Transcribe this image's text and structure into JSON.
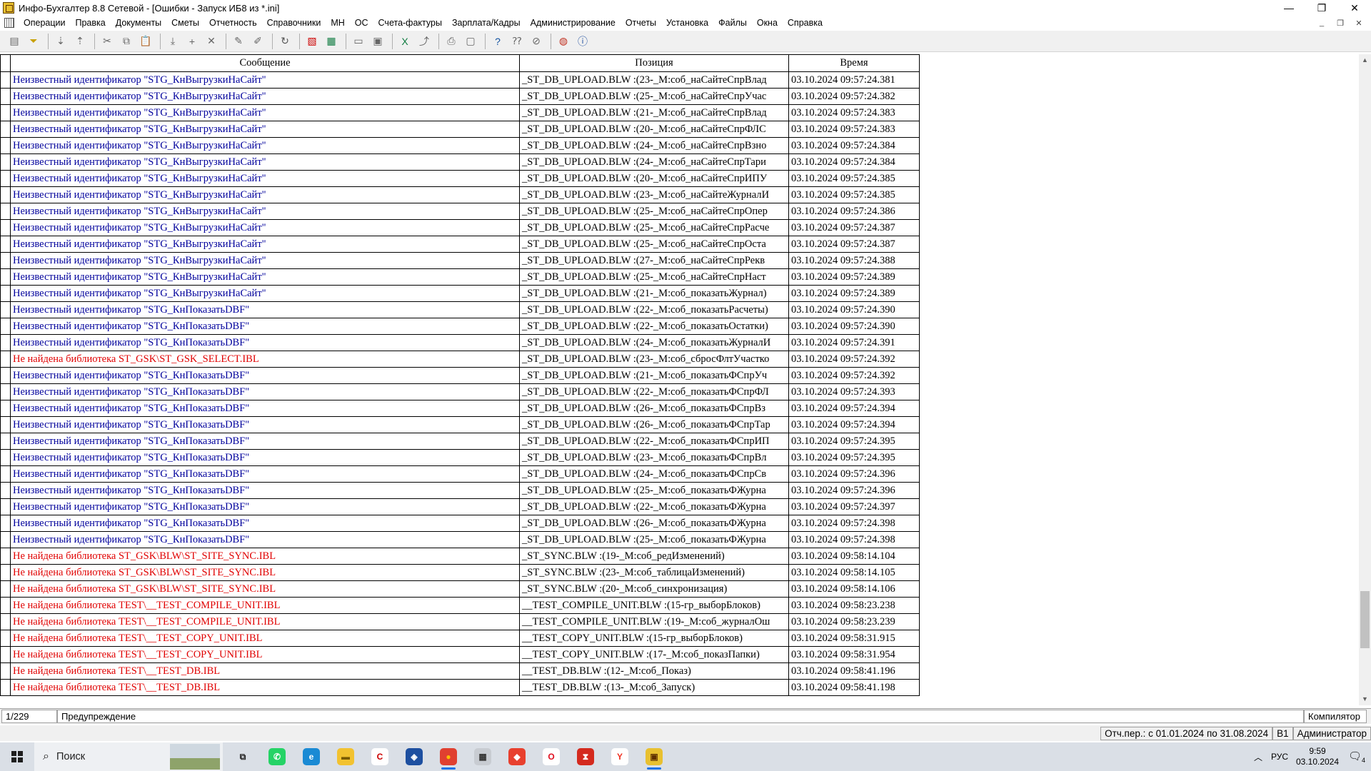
{
  "window": {
    "title": "Инфо-Бухгалтер 8.8 Сетевой - [Ошибки - Запуск ИБ8 из *.ini]",
    "minimize": "—",
    "restore": "❐",
    "close": "✕"
  },
  "menu": [
    "Операции",
    "Правка",
    "Документы",
    "Сметы",
    "Отчетность",
    "Справочники",
    "МН",
    "ОС",
    "Счета-фактуры",
    "Зарплата/Кадры",
    "Администрирование",
    "Отчеты",
    "Установка",
    "Файлы",
    "Окна",
    "Справка"
  ],
  "toolbar_icons": [
    "table-icon",
    "filter-icon",
    "sort-asc-icon",
    "sort-desc-icon",
    "cut-icon",
    "copy-icon",
    "paste-icon",
    "insert-row-icon",
    "add-icon",
    "delete-icon",
    "mark-icon",
    "unmark-icon",
    "refresh-icon",
    "pdf-icon",
    "calculator-icon",
    "open-icon",
    "save-icon",
    "excel-icon",
    "export-icon",
    "print-icon",
    "preview-icon",
    "help-icon",
    "context-help-icon",
    "compass-icon",
    "web-icon",
    "info-icon"
  ],
  "table": {
    "columns": [
      "Сообщение",
      "Позиция",
      "Время"
    ],
    "rows": [
      {
        "msg": "Неизвестный идентификатор \"STG_КнВыгрузкиНаСайт\"",
        "pos": "_ST_DB_UPLOAD.BLW :(23-_М:соб_наСайтеСпрВлад",
        "time": "03.10.2024 09:57:24.381",
        "level": "warn"
      },
      {
        "msg": "Неизвестный идентификатор \"STG_КнВыгрузкиНаСайт\"",
        "pos": "_ST_DB_UPLOAD.BLW :(25-_М:соб_наСайтеСпрУчас",
        "time": "03.10.2024 09:57:24.382",
        "level": "warn"
      },
      {
        "msg": "Неизвестный идентификатор \"STG_КнВыгрузкиНаСайт\"",
        "pos": "_ST_DB_UPLOAD.BLW :(21-_М:соб_наСайтеСпрВлад",
        "time": "03.10.2024 09:57:24.383",
        "level": "warn"
      },
      {
        "msg": "Неизвестный идентификатор \"STG_КнВыгрузкиНаСайт\"",
        "pos": "_ST_DB_UPLOAD.BLW :(20-_М:соб_наСайтеСпрФЛС",
        "time": "03.10.2024 09:57:24.383",
        "level": "warn"
      },
      {
        "msg": "Неизвестный идентификатор \"STG_КнВыгрузкиНаСайт\"",
        "pos": "_ST_DB_UPLOAD.BLW :(24-_М:соб_наСайтеСпрВзно",
        "time": "03.10.2024 09:57:24.384",
        "level": "warn"
      },
      {
        "msg": "Неизвестный идентификатор \"STG_КнВыгрузкиНаСайт\"",
        "pos": "_ST_DB_UPLOAD.BLW :(24-_М:соб_наСайтеСпрТари",
        "time": "03.10.2024 09:57:24.384",
        "level": "warn"
      },
      {
        "msg": "Неизвестный идентификатор \"STG_КнВыгрузкиНаСайт\"",
        "pos": "_ST_DB_UPLOAD.BLW :(20-_М:соб_наСайтеСпрИПУ",
        "time": "03.10.2024 09:57:24.385",
        "level": "warn"
      },
      {
        "msg": "Неизвестный идентификатор \"STG_КнВыгрузкиНаСайт\"",
        "pos": "_ST_DB_UPLOAD.BLW :(23-_М:соб_наСайтеЖурналИ",
        "time": "03.10.2024 09:57:24.385",
        "level": "warn"
      },
      {
        "msg": "Неизвестный идентификатор \"STG_КнВыгрузкиНаСайт\"",
        "pos": "_ST_DB_UPLOAD.BLW :(25-_М:соб_наСайтеСпрОпер",
        "time": "03.10.2024 09:57:24.386",
        "level": "warn"
      },
      {
        "msg": "Неизвестный идентификатор \"STG_КнВыгрузкиНаСайт\"",
        "pos": "_ST_DB_UPLOAD.BLW :(25-_М:соб_наСайтеСпрРасче",
        "time": "03.10.2024 09:57:24.387",
        "level": "warn"
      },
      {
        "msg": "Неизвестный идентификатор \"STG_КнВыгрузкиНаСайт\"",
        "pos": "_ST_DB_UPLOAD.BLW :(25-_М:соб_наСайтеСпрОста",
        "time": "03.10.2024 09:57:24.387",
        "level": "warn"
      },
      {
        "msg": "Неизвестный идентификатор \"STG_КнВыгрузкиНаСайт\"",
        "pos": "_ST_DB_UPLOAD.BLW :(27-_М:соб_наСайтеСпрРекв",
        "time": "03.10.2024 09:57:24.388",
        "level": "warn"
      },
      {
        "msg": "Неизвестный идентификатор \"STG_КнВыгрузкиНаСайт\"",
        "pos": "_ST_DB_UPLOAD.BLW :(25-_М:соб_наСайтеСпрНаст",
        "time": "03.10.2024 09:57:24.389",
        "level": "warn"
      },
      {
        "msg": "Неизвестный идентификатор \"STG_КнВыгрузкиНаСайт\"",
        "pos": "_ST_DB_UPLOAD.BLW :(21-_М:соб_показатьЖурнал)",
        "time": "03.10.2024 09:57:24.389",
        "level": "warn"
      },
      {
        "msg": "Неизвестный идентификатор \"STG_КнПоказатьDBF\"",
        "pos": "_ST_DB_UPLOAD.BLW :(22-_М:соб_показатьРасчеты)",
        "time": "03.10.2024 09:57:24.390",
        "level": "warn"
      },
      {
        "msg": "Неизвестный идентификатор \"STG_КнПоказатьDBF\"",
        "pos": "_ST_DB_UPLOAD.BLW :(22-_М:соб_показатьОстатки)",
        "time": "03.10.2024 09:57:24.390",
        "level": "warn"
      },
      {
        "msg": "Неизвестный идентификатор \"STG_КнПоказатьDBF\"",
        "pos": "_ST_DB_UPLOAD.BLW :(24-_М:соб_показатьЖурналИ",
        "time": "03.10.2024 09:57:24.391",
        "level": "warn"
      },
      {
        "msg": "Не найдена библиотека ST_GSK\\ST_GSK_SELECT.IBL",
        "pos": "_ST_DB_UPLOAD.BLW :(23-_М:соб_сбросФлтУчастко",
        "time": "03.10.2024 09:57:24.392",
        "level": "error"
      },
      {
        "msg": "Неизвестный идентификатор \"STG_КнПоказатьDBF\"",
        "pos": "_ST_DB_UPLOAD.BLW :(21-_М:соб_показатьФСпрУч",
        "time": "03.10.2024 09:57:24.392",
        "level": "warn"
      },
      {
        "msg": "Неизвестный идентификатор \"STG_КнПоказатьDBF\"",
        "pos": "_ST_DB_UPLOAD.BLW :(22-_М:соб_показатьФСпрФЛ",
        "time": "03.10.2024 09:57:24.393",
        "level": "warn"
      },
      {
        "msg": "Неизвестный идентификатор \"STG_КнПоказатьDBF\"",
        "pos": "_ST_DB_UPLOAD.BLW :(26-_М:соб_показатьФСпрВз",
        "time": "03.10.2024 09:57:24.394",
        "level": "warn"
      },
      {
        "msg": "Неизвестный идентификатор \"STG_КнПоказатьDBF\"",
        "pos": "_ST_DB_UPLOAD.BLW :(26-_М:соб_показатьФСпрТар",
        "time": "03.10.2024 09:57:24.394",
        "level": "warn"
      },
      {
        "msg": "Неизвестный идентификатор \"STG_КнПоказатьDBF\"",
        "pos": "_ST_DB_UPLOAD.BLW :(22-_М:соб_показатьФСпрИП",
        "time": "03.10.2024 09:57:24.395",
        "level": "warn"
      },
      {
        "msg": "Неизвестный идентификатор \"STG_КнПоказатьDBF\"",
        "pos": "_ST_DB_UPLOAD.BLW :(23-_М:соб_показатьФСпрВл",
        "time": "03.10.2024 09:57:24.395",
        "level": "warn"
      },
      {
        "msg": "Неизвестный идентификатор \"STG_КнПоказатьDBF\"",
        "pos": "_ST_DB_UPLOAD.BLW :(24-_М:соб_показатьФСпрСв",
        "time": "03.10.2024 09:57:24.396",
        "level": "warn"
      },
      {
        "msg": "Неизвестный идентификатор \"STG_КнПоказатьDBF\"",
        "pos": "_ST_DB_UPLOAD.BLW :(25-_М:соб_показатьФЖурна",
        "time": "03.10.2024 09:57:24.396",
        "level": "warn"
      },
      {
        "msg": "Неизвестный идентификатор \"STG_КнПоказатьDBF\"",
        "pos": "_ST_DB_UPLOAD.BLW :(22-_М:соб_показатьФЖурна",
        "time": "03.10.2024 09:57:24.397",
        "level": "warn"
      },
      {
        "msg": "Неизвестный идентификатор \"STG_КнПоказатьDBF\"",
        "pos": "_ST_DB_UPLOAD.BLW :(26-_М:соб_показатьФЖурна",
        "time": "03.10.2024 09:57:24.398",
        "level": "warn"
      },
      {
        "msg": "Неизвестный идентификатор \"STG_КнПоказатьDBF\"",
        "pos": "_ST_DB_UPLOAD.BLW :(25-_М:соб_показатьФЖурна",
        "time": "03.10.2024 09:57:24.398",
        "level": "warn"
      },
      {
        "msg": "Не найдена библиотека ST_GSK\\BLW\\ST_SITE_SYNC.IBL",
        "pos": "_ST_SYNC.BLW :(19-_М:соб_редИзменений)",
        "time": "03.10.2024 09:58:14.104",
        "level": "error"
      },
      {
        "msg": "Не найдена библиотека ST_GSK\\BLW\\ST_SITE_SYNC.IBL",
        "pos": "_ST_SYNC.BLW :(23-_М:соб_таблицаИзменений)",
        "time": "03.10.2024 09:58:14.105",
        "level": "error"
      },
      {
        "msg": "Не найдена библиотека ST_GSK\\BLW\\ST_SITE_SYNC.IBL",
        "pos": "_ST_SYNC.BLW :(20-_М:соб_синхронизация)",
        "time": "03.10.2024 09:58:14.106",
        "level": "error"
      },
      {
        "msg": "Не найдена библиотека TEST\\__TEST_COMPILE_UNIT.IBL",
        "pos": "__TEST_COMPILE_UNIT.BLW :(15-гр_выборБлоков)",
        "time": "03.10.2024 09:58:23.238",
        "level": "error"
      },
      {
        "msg": "Не найдена библиотека TEST\\__TEST_COMPILE_UNIT.IBL",
        "pos": "__TEST_COMPILE_UNIT.BLW :(19-_М:соб_журналОш",
        "time": "03.10.2024 09:58:23.239",
        "level": "error"
      },
      {
        "msg": "Не найдена библиотека TEST\\__TEST_COPY_UNIT.IBL",
        "pos": "__TEST_COPY_UNIT.BLW :(15-гр_выборБлоков)",
        "time": "03.10.2024 09:58:31.915",
        "level": "error"
      },
      {
        "msg": "Не найдена библиотека TEST\\__TEST_COPY_UNIT.IBL",
        "pos": "__TEST_COPY_UNIT.BLW :(17-_М:соб_показПапки)",
        "time": "03.10.2024 09:58:31.954",
        "level": "error"
      },
      {
        "msg": "Не найдена библиотека TEST\\__TEST_DB.IBL",
        "pos": "__TEST_DB.BLW :(12-_М:соб_Показ)",
        "time": "03.10.2024 09:58:41.196",
        "level": "error"
      },
      {
        "msg": "Не найдена библиотека TEST\\__TEST_DB.IBL",
        "pos": "__TEST_DB.BLW :(13-_М:соб_Запуск)",
        "time": "03.10.2024 09:58:41.198",
        "level": "error"
      }
    ]
  },
  "status": {
    "counter": "1/229",
    "type": "Предупреждение",
    "source": "Компилятор"
  },
  "status2": {
    "period": "Отч.пер.: с 01.01.2024 по 31.08.2024",
    "code": "В1",
    "user": "Администратор"
  },
  "taskbar": {
    "search_placeholder": "Поиск",
    "apps": [
      {
        "name": "task-view-icon",
        "glyph": "⧉",
        "color": "#dadfe6",
        "fg": "#222"
      },
      {
        "name": "whatsapp-icon",
        "glyph": "✆",
        "color": "#25d366",
        "fg": "#fff"
      },
      {
        "name": "edge-icon",
        "glyph": "e",
        "color": "#1a8ad4",
        "fg": "#fff"
      },
      {
        "name": "file-explorer-icon",
        "glyph": "▬",
        "color": "#f2c230",
        "fg": "#7a5a00"
      },
      {
        "name": "ccleaner-icon",
        "glyph": "C",
        "color": "#ffffff",
        "fg": "#c00"
      },
      {
        "name": "app-blue-icon",
        "glyph": "◈",
        "color": "#1d4fa0",
        "fg": "#fff"
      },
      {
        "name": "chrome-icon",
        "glyph": "●",
        "color": "#e04030",
        "fg": "#fbc000"
      },
      {
        "name": "calculator-app-icon",
        "glyph": "▦",
        "color": "#c8ccd2",
        "fg": "#333"
      },
      {
        "name": "anydesk-icon",
        "glyph": "◆",
        "color": "#e8402e",
        "fg": "#fff"
      },
      {
        "name": "opera-icon",
        "glyph": "O",
        "color": "#ffffff",
        "fg": "#e01020"
      },
      {
        "name": "pdf-reader-icon",
        "glyph": "⧗",
        "color": "#d42a1e",
        "fg": "#fff"
      },
      {
        "name": "yandex-icon",
        "glyph": "Y",
        "color": "#ffffff",
        "fg": "#f03020"
      },
      {
        "name": "infobuh-icon",
        "glyph": "▣",
        "color": "#e8c030",
        "fg": "#603000"
      }
    ],
    "language": "РУС",
    "time": "9:59",
    "date": "03.10.2024",
    "notifications": "4"
  }
}
